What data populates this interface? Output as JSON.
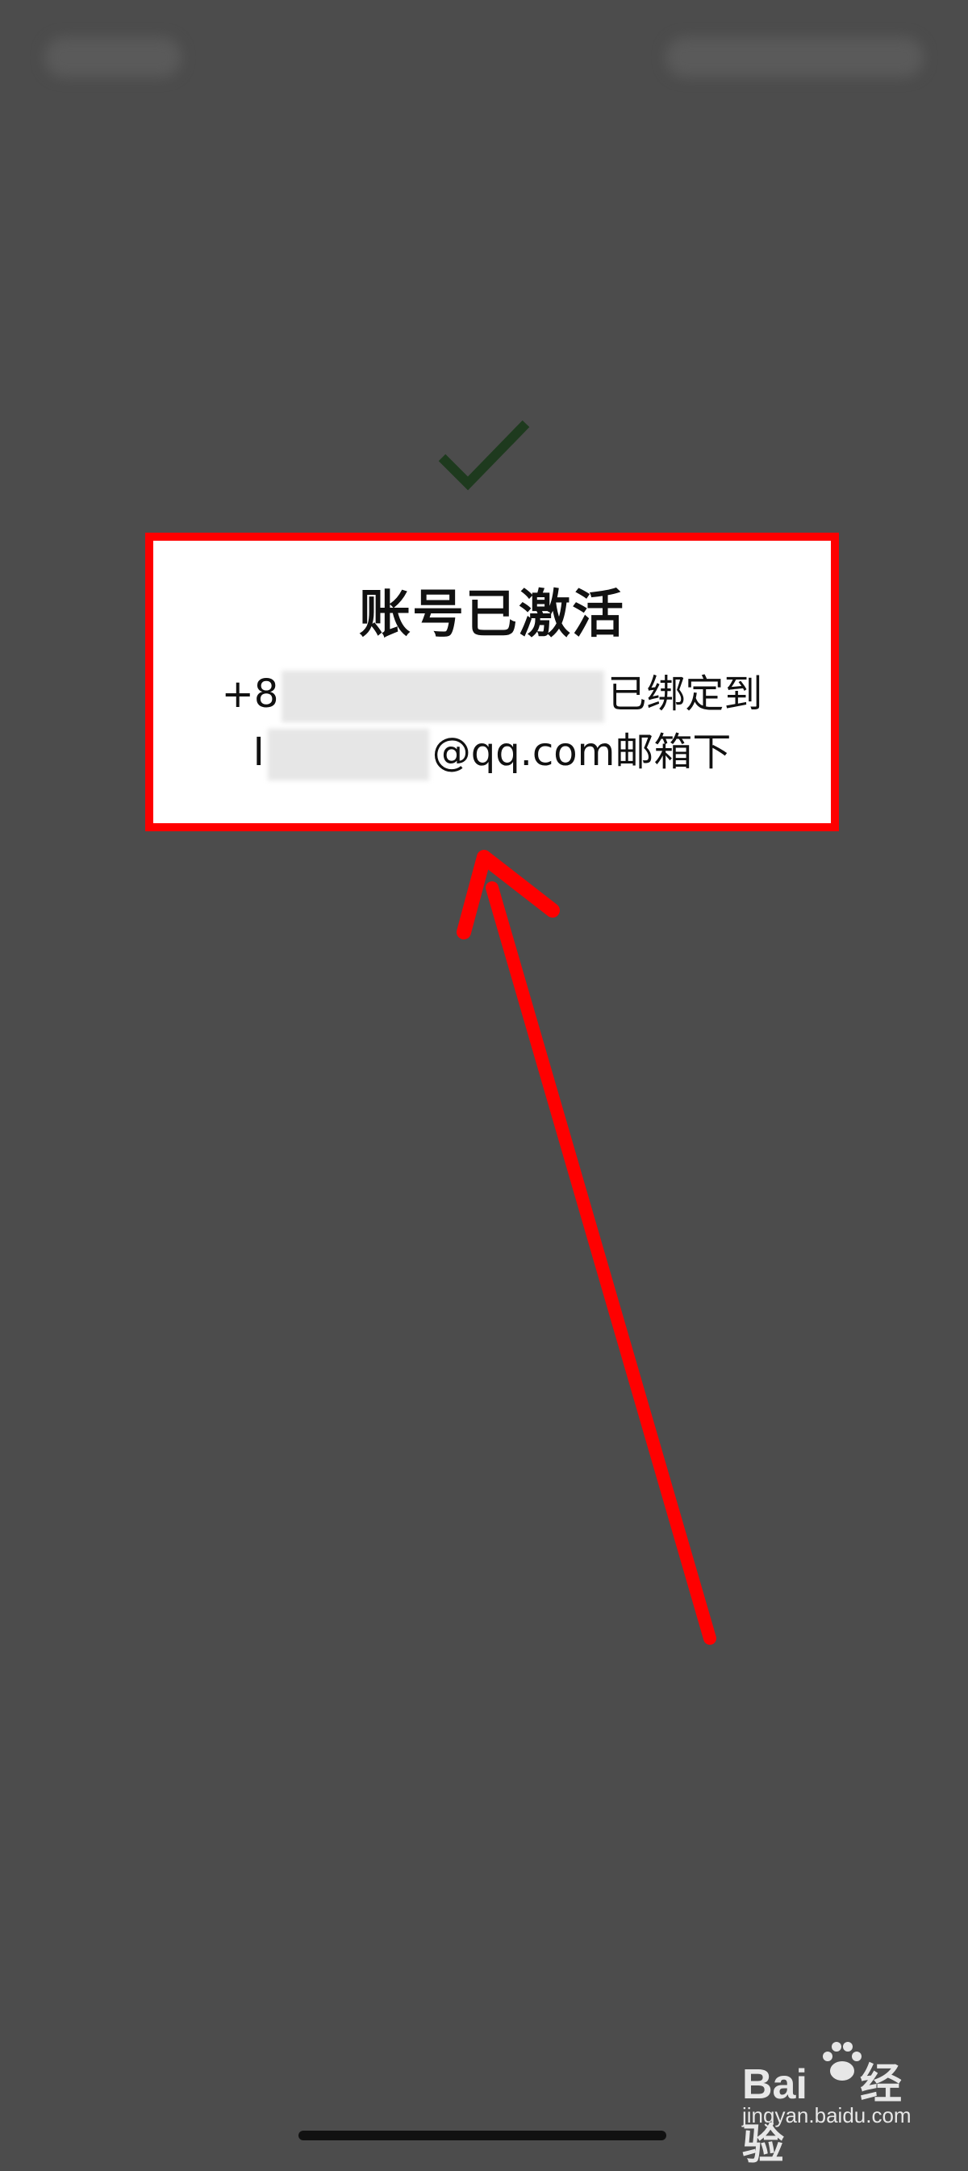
{
  "dialog": {
    "title": "账号已激活",
    "line1_prefix": "+8",
    "line1_suffix": "已绑定到",
    "line2_prefix": "I",
    "line2_suffix": "@qq.com邮箱下"
  },
  "watermark": {
    "logo_left": "Bai",
    "logo_right": "经验",
    "url": "jingyan.baidu.com"
  },
  "colors": {
    "overlay_background": "#4c4c4c",
    "check_icon": "#1e3a1e",
    "annotation_red": "#ff0000"
  },
  "icons": [
    "check-icon",
    "arrow-annotation",
    "baidu-paw-icon"
  ]
}
